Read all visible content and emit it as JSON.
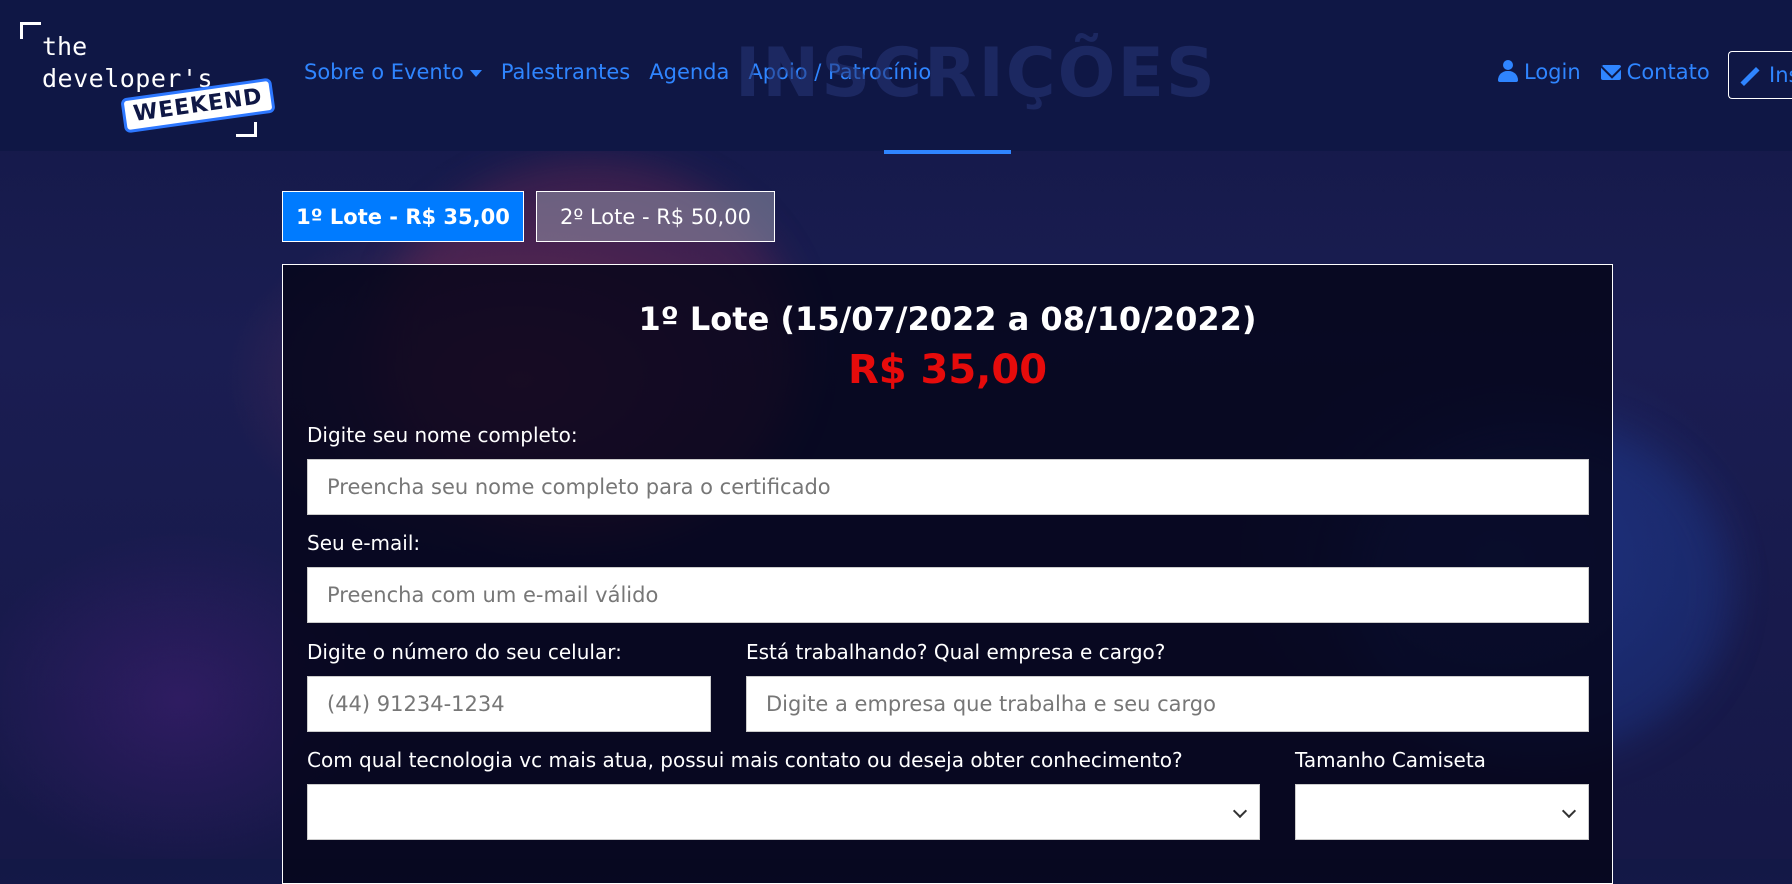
{
  "logo": {
    "line1": "the",
    "line2": "developer's",
    "badge": "WEEKEND"
  },
  "nav": {
    "items": [
      {
        "label": "Sobre o Evento",
        "dropdown": true
      },
      {
        "label": "Palestrantes"
      },
      {
        "label": "Agenda"
      },
      {
        "label": "Apoio / Patrocínio"
      }
    ],
    "login": "Login",
    "contact": "Contato",
    "signup": "Ins"
  },
  "watermark": "INSCRIÇÕES",
  "tabs": [
    {
      "label": "1º Lote - R$ 35,00",
      "active": true
    },
    {
      "label": "2º Lote - R$ 50,00",
      "active": false
    }
  ],
  "form": {
    "title": "1º Lote (15/07/2022 a 08/10/2022)",
    "price": "R$ 35,00",
    "name_label": "Digite seu nome completo:",
    "name_placeholder": "Preencha seu nome completo para o certificado",
    "email_label": "Seu e-mail:",
    "email_placeholder": "Preencha com um e-mail válido",
    "phone_label": "Digite o número do seu celular:",
    "phone_placeholder": "(44) 91234-1234",
    "job_label": "Está trabalhando? Qual empresa e cargo?",
    "job_placeholder": "Digite a empresa que trabalha e seu cargo",
    "tech_label": "Com qual tecnologia vc mais atua, possui mais contato ou deseja obter conhecimento?",
    "tech_value": "",
    "shirt_label": "Tamanho Camiseta",
    "shirt_value": ""
  },
  "colors": {
    "accent": "#2f85ff",
    "primary_button": "#007bff",
    "price": "#e60b0b",
    "navbar": "#0f1745"
  }
}
